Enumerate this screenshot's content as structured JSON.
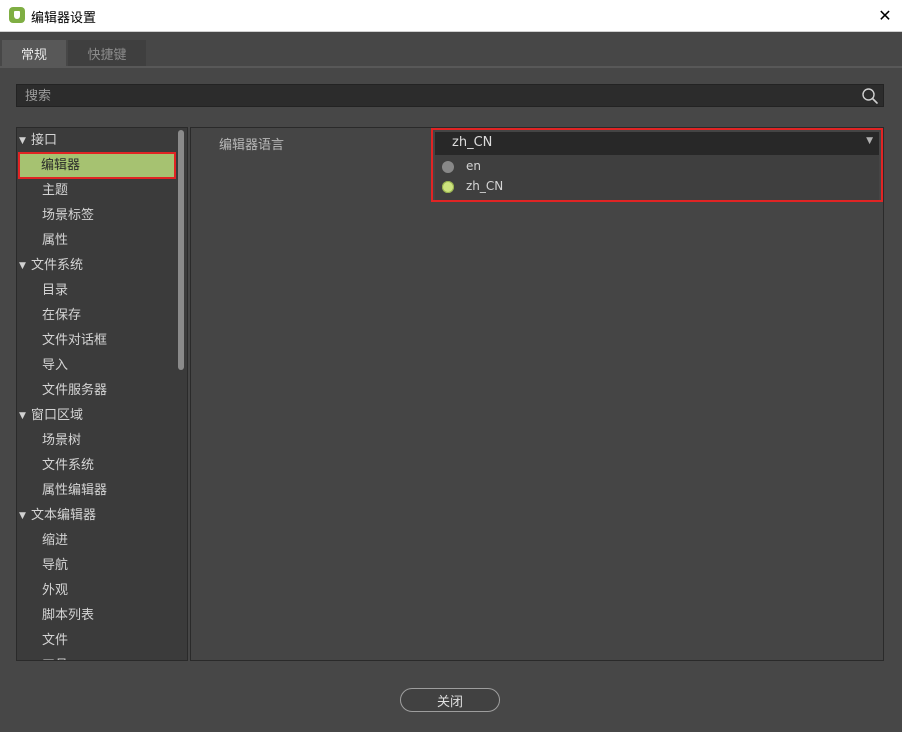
{
  "window": {
    "title": "编辑器设置",
    "close_symbol": "✕"
  },
  "tabs": [
    {
      "label": "常规",
      "active": true
    },
    {
      "label": "快捷键",
      "active": false
    }
  ],
  "search": {
    "placeholder": "搜索",
    "value": ""
  },
  "tree": {
    "expand_symbol": "▼",
    "items": [
      {
        "label": "接口",
        "type": "category"
      },
      {
        "label": "编辑器",
        "type": "child",
        "selected": true
      },
      {
        "label": "主题",
        "type": "child"
      },
      {
        "label": "场景标签",
        "type": "child"
      },
      {
        "label": "属性",
        "type": "child"
      },
      {
        "label": "文件系统",
        "type": "category"
      },
      {
        "label": "目录",
        "type": "child"
      },
      {
        "label": "在保存",
        "type": "child"
      },
      {
        "label": "文件对话框",
        "type": "child"
      },
      {
        "label": "导入",
        "type": "child"
      },
      {
        "label": "文件服务器",
        "type": "child"
      },
      {
        "label": "窗口区域",
        "type": "category"
      },
      {
        "label": "场景树",
        "type": "child"
      },
      {
        "label": "文件系统",
        "type": "child"
      },
      {
        "label": "属性编辑器",
        "type": "child"
      },
      {
        "label": "文本编辑器",
        "type": "category"
      },
      {
        "label": "缩进",
        "type": "child"
      },
      {
        "label": "导航",
        "type": "child"
      },
      {
        "label": "外观",
        "type": "child"
      },
      {
        "label": "脚本列表",
        "type": "child"
      },
      {
        "label": "文件",
        "type": "child"
      },
      {
        "label": "工具",
        "type": "child"
      }
    ]
  },
  "setting": {
    "label": "编辑器语言",
    "selected_value": "zh_CN",
    "dropdown_arrow": "▼",
    "options": [
      {
        "label": "en",
        "checked": false
      },
      {
        "label": "zh_CN",
        "checked": true
      }
    ]
  },
  "footer": {
    "close_label": "关闭"
  },
  "colors": {
    "selected_bg": "#a6c271",
    "highlight_border": "#e02424",
    "radio_on": "#cde37e",
    "app_icon": "#7fae43"
  }
}
